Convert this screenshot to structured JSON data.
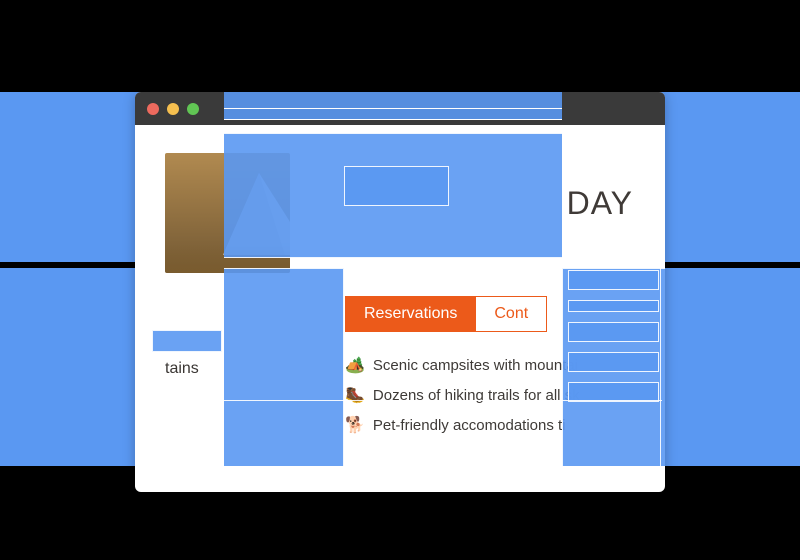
{
  "headline": "DAY",
  "tabs": {
    "reservations": "Reservations",
    "contact": "Cont"
  },
  "sidebar": {
    "caption_fragment": "tains"
  },
  "features": [
    {
      "icon": "🏕️",
      "text": "Scenic campsites with mountai"
    },
    {
      "icon": "🥾",
      "text": "Dozens of hiking trails for all sk"
    },
    {
      "icon": "🐕",
      "text": "Pet-friendly accomodations ti"
    }
  ]
}
